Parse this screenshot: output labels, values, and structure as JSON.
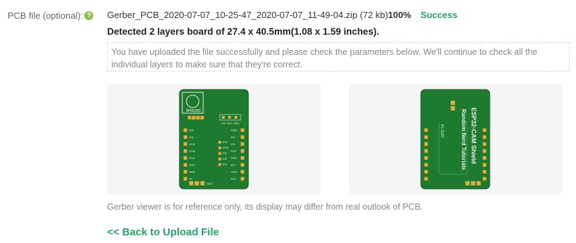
{
  "field": {
    "label": "PCB file (optional):",
    "help_icon": "question-circle-icon"
  },
  "upload": {
    "filename": "Gerber_PCB_2020-07-07_10-25-47_2020-07-07_11-49-04.zip",
    "size": "(72 kb)",
    "progress": "100%",
    "status": "Success",
    "status_color": "#27a065"
  },
  "detected": "Detected 2 layers board of 27.4 x 40.5mm(1.08 x 1.59 inches).",
  "notice": "You have uploaded the file successfully and please check the parameters below. We'll continue to check all the individual layers to make sure that they're correct.",
  "previews": {
    "top": {
      "sensor_label": "BME280",
      "header_labels": [
        "3V3",
        "IO13",
        "GND"
      ],
      "left_pins": [
        "IO4",
        "IO2",
        "IO14",
        "IO15",
        "IO13",
        "IO12",
        "GND",
        "5V"
      ],
      "mid_pins": [
        "3V3",
        "IO16",
        "IO0",
        "IO3",
        "IO1"
      ],
      "right_pins": [
        "GND",
        "IO7",
        "IO0",
        "VCC",
        "GND",
        "IO1",
        "GND",
        "3V3"
      ],
      "bottom_label": "GND"
    },
    "bottom": {
      "title": "ESP32-CAM Shield",
      "subtitle": "Random Nerd Tutorials",
      "year": "R1 2020"
    },
    "pcb_color": "#1e7a2e"
  },
  "reference_note": "Gerber viewer is for reference only, its display may differ from real outlook of PCB.",
  "back_link": "<< Back to Upload File"
}
